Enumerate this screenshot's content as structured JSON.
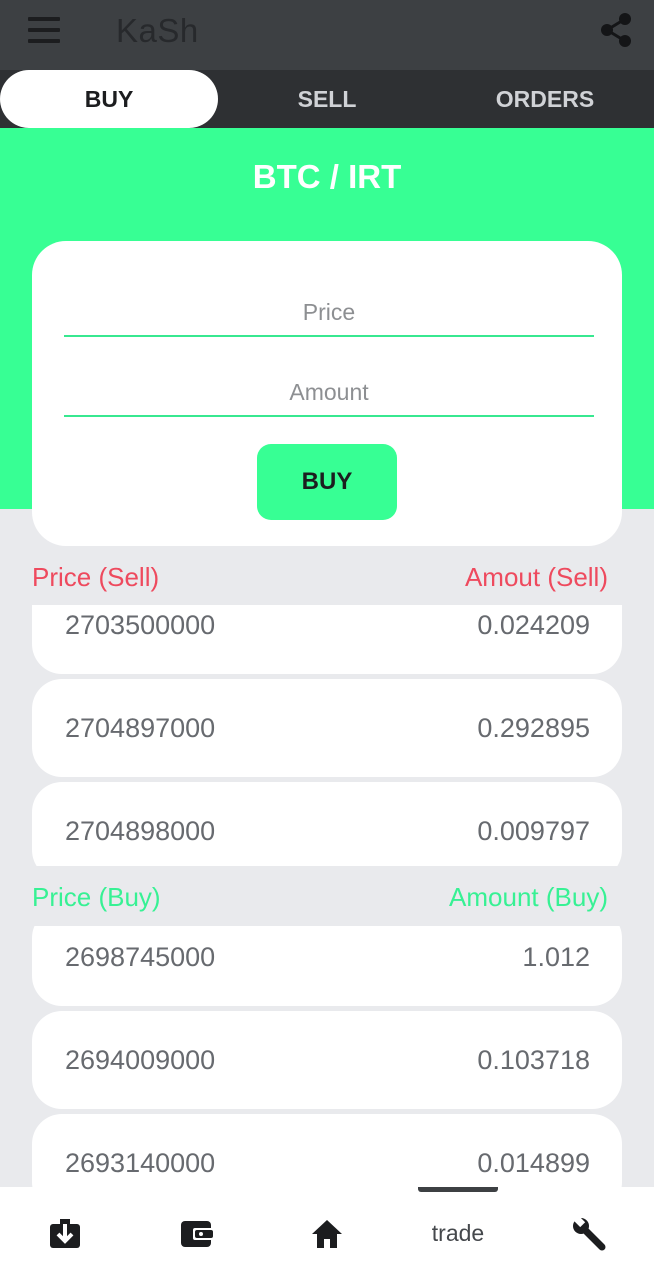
{
  "app": {
    "title": "KaSh"
  },
  "icons": {
    "menu": "hamburger-menu-icon",
    "share": "share-icon"
  },
  "tabs": [
    {
      "label": "BUY",
      "active": true
    },
    {
      "label": "SELL",
      "active": false
    },
    {
      "label": "ORDERS",
      "active": false
    }
  ],
  "pair": "BTC / IRT",
  "form": {
    "price_placeholder": "Price",
    "amount_placeholder": "Amount",
    "submit_label": "BUY"
  },
  "sell_orders": {
    "price_header": "Price (Sell)",
    "amount_header": "Amout (Sell)",
    "rows": [
      {
        "price": "2703500000",
        "amount": "0.024209"
      },
      {
        "price": "2704897000",
        "amount": "0.292895"
      },
      {
        "price": "2704898000",
        "amount": "0.009797"
      }
    ]
  },
  "buy_orders": {
    "price_header": "Price (Buy)",
    "amount_header": "Amount (Buy)",
    "rows": [
      {
        "price": "2698745000",
        "amount": "1.012"
      },
      {
        "price": "2694009000",
        "amount": "0.103718"
      },
      {
        "price": "2693140000",
        "amount": "0.014899"
      }
    ]
  },
  "bottom_nav": [
    {
      "icon": "deposit-icon"
    },
    {
      "icon": "wallet-icon"
    },
    {
      "icon": "home-icon"
    },
    {
      "label": "trade",
      "active": true
    },
    {
      "icon": "wrench-icon"
    }
  ],
  "colors": {
    "accent": "#37ff94",
    "sell": "#ee4a5e",
    "buy": "#37f194",
    "appbar": "#3d4043",
    "tabbar": "#2e3033"
  }
}
